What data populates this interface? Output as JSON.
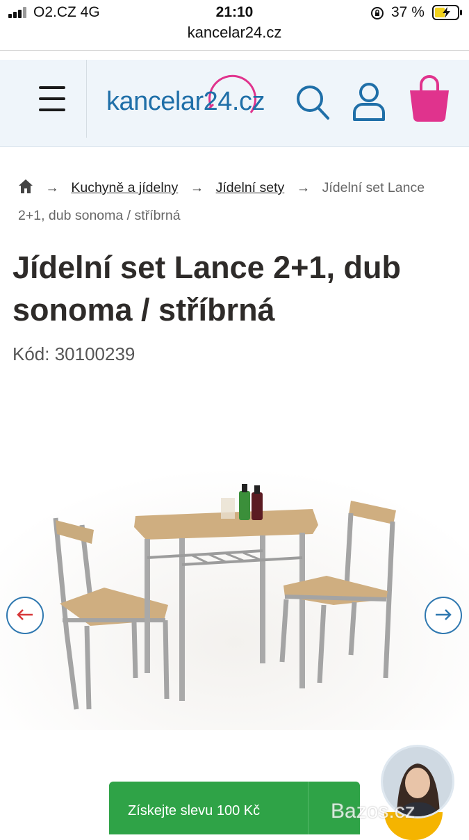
{
  "status_bar": {
    "carrier": "O2.CZ   4G",
    "time": "21:10",
    "battery": "37 %",
    "url": "kancelar24.cz"
  },
  "header": {
    "logo_text": "kancelar24.cz",
    "brand_color": "#1f6fa8",
    "accent_color": "#e0338d",
    "icons": [
      "menu-icon",
      "search-icon",
      "user-icon",
      "cart-icon"
    ]
  },
  "breadcrumb": {
    "items": [
      "Kuchyně a jídelny",
      "Jídelní sety"
    ],
    "separator": "→",
    "current": "Jídelní set Lance 2+1, dub sonoma / stříbrná"
  },
  "product": {
    "title": "Jídelní set Lance 2+1, dub sonoma / stříbrná",
    "code": "Kód: 30100239",
    "prev_arrow": "←",
    "next_arrow": "→"
  },
  "cta": {
    "label": "Získejte slevu 100 Kč",
    "color": "#2fa347"
  },
  "watermark": "Bazos.cz"
}
